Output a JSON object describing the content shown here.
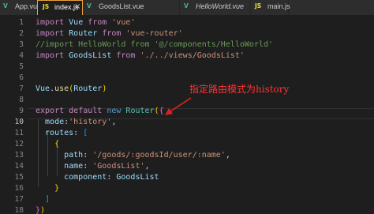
{
  "tabs": [
    {
      "label": "App.vue",
      "icon": "vue-icon",
      "icon_glyph": "V",
      "icon_color": "#41b883",
      "italic": false,
      "active": false
    },
    {
      "label": "index.js",
      "icon": "js-icon",
      "icon_glyph": "JS",
      "icon_color": "#f1dd35",
      "italic": false,
      "active": true
    },
    {
      "label": "GoodsList.vue",
      "icon": "vue-icon",
      "icon_glyph": "V",
      "icon_color": "#41b883",
      "italic": false,
      "active": false
    },
    {
      "label": "HelloWorld.vue",
      "icon": "vue-icon",
      "icon_glyph": "V",
      "icon_color": "#41b883",
      "italic": true,
      "active": false
    },
    {
      "label": "main.js",
      "icon": "js-icon",
      "icon_glyph": "JS",
      "icon_color": "#f1dd35",
      "italic": false,
      "active": false
    }
  ],
  "close_glyph": "×",
  "editor": {
    "current_line": 10,
    "lines": [
      {
        "n": "1",
        "tokens": [
          {
            "t": "import ",
            "c": "k"
          },
          {
            "t": "Vue ",
            "c": "v"
          },
          {
            "t": "from ",
            "c": "k"
          },
          {
            "t": "'vue'",
            "c": "s"
          }
        ]
      },
      {
        "n": "2",
        "tokens": [
          {
            "t": "import ",
            "c": "k"
          },
          {
            "t": "Router ",
            "c": "v"
          },
          {
            "t": "from ",
            "c": "k"
          },
          {
            "t": "'vue-router'",
            "c": "s"
          }
        ]
      },
      {
        "n": "3",
        "tokens": [
          {
            "t": "//import HelloWorld from '@/components/HelloWorld'",
            "c": "c"
          }
        ]
      },
      {
        "n": "4",
        "tokens": [
          {
            "t": "import ",
            "c": "k"
          },
          {
            "t": "GoodsList ",
            "c": "v"
          },
          {
            "t": "from ",
            "c": "k"
          },
          {
            "t": "'./../views/GoodsList'",
            "c": "s"
          }
        ]
      },
      {
        "n": "5",
        "tokens": []
      },
      {
        "n": "6",
        "tokens": []
      },
      {
        "n": "7",
        "tokens": [
          {
            "t": "Vue",
            "c": "v"
          },
          {
            "t": ".",
            "c": "p"
          },
          {
            "t": "use",
            "c": "f"
          },
          {
            "t": "(",
            "c": "b1"
          },
          {
            "t": "Router",
            "c": "v"
          },
          {
            "t": ")",
            "c": "b1"
          }
        ]
      },
      {
        "n": "8",
        "tokens": []
      },
      {
        "n": "9",
        "tokens": [
          {
            "t": "export ",
            "c": "k"
          },
          {
            "t": "default ",
            "c": "k"
          },
          {
            "t": "new ",
            "c": "kb"
          },
          {
            "t": "Router",
            "c": "t"
          },
          {
            "t": "(",
            "c": "b1"
          },
          {
            "t": "{",
            "c": "b2"
          }
        ]
      },
      {
        "n": "10",
        "tokens": [
          {
            "t": "  mode",
            "c": "v"
          },
          {
            "t": ":",
            "c": "p"
          },
          {
            "t": "'history'",
            "c": "s"
          },
          {
            "t": ",",
            "c": "p"
          }
        ]
      },
      {
        "n": "11",
        "tokens": [
          {
            "t": "  routes",
            "c": "v"
          },
          {
            "t": ": ",
            "c": "p"
          },
          {
            "t": "[",
            "c": "b3"
          }
        ]
      },
      {
        "n": "12",
        "tokens": [
          {
            "t": "    ",
            "c": "p"
          },
          {
            "t": "{",
            "c": "b1"
          }
        ]
      },
      {
        "n": "13",
        "tokens": [
          {
            "t": "      path",
            "c": "v"
          },
          {
            "t": ": ",
            "c": "p"
          },
          {
            "t": "'/goods/:goodsId/user/:name'",
            "c": "s"
          },
          {
            "t": ",",
            "c": "p"
          }
        ]
      },
      {
        "n": "14",
        "tokens": [
          {
            "t": "      name",
            "c": "v"
          },
          {
            "t": ": ",
            "c": "p"
          },
          {
            "t": "'GoodsList'",
            "c": "s"
          },
          {
            "t": ",",
            "c": "p"
          }
        ]
      },
      {
        "n": "15",
        "tokens": [
          {
            "t": "      component",
            "c": "v"
          },
          {
            "t": ": ",
            "c": "p"
          },
          {
            "t": "GoodsList",
            "c": "v"
          }
        ]
      },
      {
        "n": "16",
        "tokens": [
          {
            "t": "    ",
            "c": "p"
          },
          {
            "t": "}",
            "c": "b1"
          }
        ]
      },
      {
        "n": "17",
        "tokens": [
          {
            "t": "  ",
            "c": "p"
          },
          {
            "t": "]",
            "c": "b3"
          }
        ]
      },
      {
        "n": "18",
        "tokens": [
          {
            "t": "}",
            "c": "b2"
          },
          {
            "t": ")",
            "c": "b1"
          }
        ]
      }
    ]
  },
  "annotation": {
    "text": "指定路由模式为history",
    "color": "#ff3333"
  }
}
